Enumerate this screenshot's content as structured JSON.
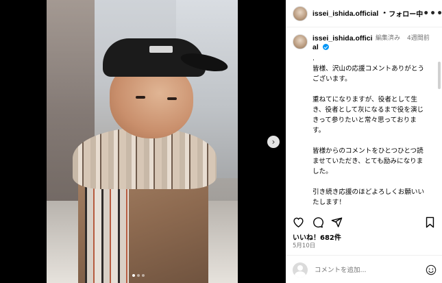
{
  "post": {
    "username": "issei_ishida.official",
    "follow_label": "フォロー中",
    "more_label": "•••",
    "separator": "•"
  },
  "caption": {
    "username_wrapped": "issei_ishida.offici al",
    "edited_label": "編集済み",
    "time_ago": "4週間前",
    "text": ".\n皆様、沢山の応援コメントありがとうございます。\n\n重ねてになりますが、役者として生き、役者として灰になるまで役を演じきって参りたいと常々思っております。\n\n皆様からのコメントをひとつひとつ読ませていただき、とても励みになりました。\n\n引き続き応援のほどよろしくお願いいたします！\n\n壱成"
  },
  "engagement": {
    "likes_label": "いいね！682件",
    "date": "5月10日"
  },
  "comment_input": {
    "placeholder": "コメントを追加..."
  },
  "carousel": {
    "next_icon": "›",
    "slide_count": 3,
    "active_index": 0
  },
  "icons": {
    "like": "heart-icon",
    "comment": "comment-icon",
    "share": "share-icon",
    "save": "bookmark-icon",
    "emoji": "emoji-icon",
    "verified": "verified-badge-icon"
  },
  "colors": {
    "verified_blue": "#0095f6",
    "secondary_text": "#737373",
    "divider": "#efefef"
  }
}
